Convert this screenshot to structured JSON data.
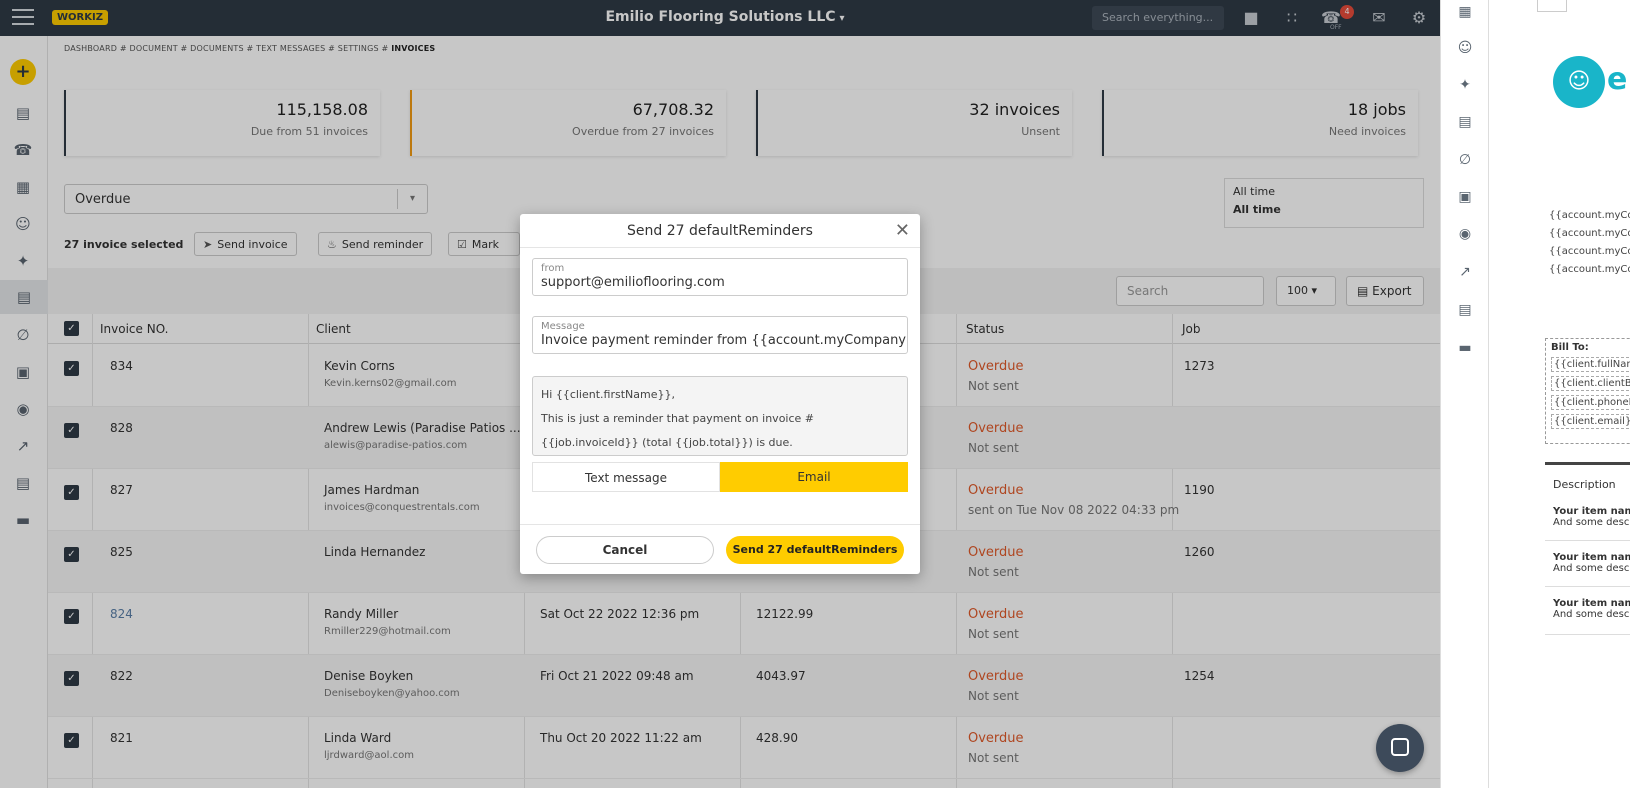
{
  "app": {
    "logo": "WORKIZ",
    "company": "Emilio Flooring Solutions LLC",
    "search_placeholder": "Search everything...",
    "notif_count": "4",
    "off_label": "OFF"
  },
  "breadcrumb": {
    "path": "DASHBOARD # DOCUMENT # DOCUMENTS # TEXT MESSAGES # SETTINGS # ",
    "current": "INVOICES"
  },
  "stats": [
    {
      "big": "115,158.08",
      "small": "Due from 51 invoices"
    },
    {
      "big": "67,708.32",
      "small": "Overdue from 27 invoices"
    },
    {
      "big": "32 invoices",
      "small": "Unsent"
    },
    {
      "big": "18 jobs",
      "small": "Need invoices"
    }
  ],
  "filter": {
    "value": "Overdue"
  },
  "time": {
    "label": "All time",
    "value": "All time"
  },
  "selection": {
    "count_label": "27 invoice selected",
    "send_invoice": "Send invoice",
    "send_reminder": "Send reminder",
    "mark": "Mark"
  },
  "table": {
    "search_placeholder": "Search",
    "per_page": "100",
    "export": "Export",
    "headers": {
      "invoice": "Invoice NO.",
      "client": "Client",
      "status": "Status",
      "job": "Job"
    },
    "rows": [
      {
        "no": "834",
        "name": "Kevin Corns",
        "email": "Kevin.kerns02@gmail.com",
        "date": "",
        "total": "",
        "status": "Overdue",
        "sent": "Not sent",
        "job": "1273"
      },
      {
        "no": "828",
        "name": "Andrew Lewis (Paradise Patios ...",
        "email": "alewis@paradise-patios.com",
        "date": "",
        "total": "",
        "status": "Overdue",
        "sent": "Not sent",
        "job": ""
      },
      {
        "no": "827",
        "name": "James Hardman",
        "email": "invoices@conquestrentals.com",
        "date": "",
        "total": "",
        "status": "Overdue",
        "sent": "sent on Tue Nov 08 2022 04:33 pm",
        "job": "1190"
      },
      {
        "no": "825",
        "name": "Linda Hernandez",
        "email": "",
        "date": "",
        "total": "",
        "status": "Overdue",
        "sent": "Not sent",
        "job": "1260"
      },
      {
        "no": "824",
        "name": "Randy Miller",
        "email": "Rmiller229@hotmail.com",
        "date": "Sat Oct 22 2022 12:36 pm",
        "total": "12122.99",
        "status": "Overdue",
        "sent": "Not sent",
        "job": ""
      },
      {
        "no": "822",
        "name": "Denise Boyken",
        "email": "Deniseboyken@yahoo.com",
        "date": "Fri Oct 21 2022 09:48 am",
        "total": "4043.97",
        "status": "Overdue",
        "sent": "Not sent",
        "job": "1254"
      },
      {
        "no": "821",
        "name": "Linda Ward",
        "email": "ljrdward@aol.com",
        "date": "Thu Oct 20 2022 11:22 am",
        "total": "428.90",
        "status": "Overdue",
        "sent": "Not sent",
        "job": ""
      }
    ]
  },
  "modal": {
    "title": "Send 27 defaultReminders",
    "from_label": "from",
    "from_value": "support@emilioflooring.com",
    "message_label": "Message",
    "message_value": "Invoice payment reminder from {{account.myCompany",
    "body_line1": "Hi {{client.firstName}},",
    "body_line2": "This is just a reminder that payment on invoice #",
    "body_line3": "{{job.invoiceId}} (total {{job.total}}) is due.",
    "tab_text": "Text message",
    "tab_email": "Email",
    "cancel": "Cancel",
    "send": "Send 27 defaultReminders"
  },
  "preview": {
    "lines": [
      "{{account.myCo",
      "{{account.myCo",
      "{{account.myCo",
      "{{account.myCo"
    ],
    "bill_to": "Bill To:",
    "bill_lines": [
      "{{client.fullName",
      "{{client.clientBil",
      "{{client.phoneN",
      "{{client.email}}"
    ],
    "description": "Description",
    "items": [
      {
        "name": "Your item nam",
        "desc": "And some desc"
      },
      {
        "name": "Your item nam",
        "desc": "And some desc"
      },
      {
        "name": "Your item nam",
        "desc": "And some desc"
      }
    ]
  }
}
